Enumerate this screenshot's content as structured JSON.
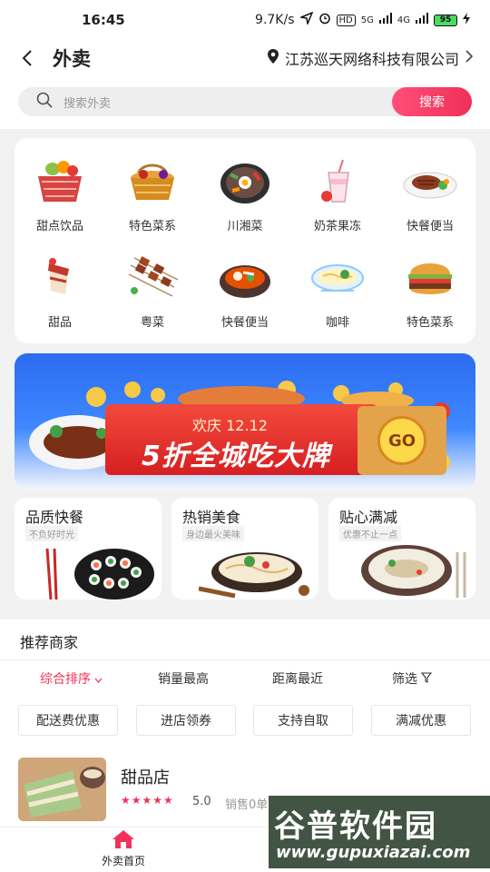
{
  "status_bar": {
    "time": "16:45",
    "speed": "9.7K/s",
    "hd": "HD",
    "network_5g": "5G",
    "network_4g": "4G",
    "battery": "95"
  },
  "nav": {
    "title": "外卖",
    "location": "江苏巡天网络科技有限公司"
  },
  "search": {
    "placeholder": "搜索外卖",
    "button": "搜索"
  },
  "categories": [
    {
      "label": "甜点饮品",
      "icon": "fruit-basket-icon"
    },
    {
      "label": "特色菜系",
      "icon": "bread-basket-icon"
    },
    {
      "label": "川湘菜",
      "icon": "bibimbap-icon"
    },
    {
      "label": "奶茶果冻",
      "icon": "milkshake-icon"
    },
    {
      "label": "快餐便当",
      "icon": "steak-plate-icon"
    },
    {
      "label": "甜品",
      "icon": "cake-icon"
    },
    {
      "label": "粤菜",
      "icon": "skewers-icon"
    },
    {
      "label": "快餐便当",
      "icon": "hotpot-icon"
    },
    {
      "label": "咖啡",
      "icon": "noodle-bowl-icon"
    },
    {
      "label": "特色菜系",
      "icon": "burger-icon"
    }
  ],
  "banner": {
    "subtitle": "欢庆 12.12",
    "headline": "5折全城吃大牌",
    "go": "GO"
  },
  "promos": [
    {
      "title": "品质快餐",
      "subtitle": "不负好时光"
    },
    {
      "title": "热销美食",
      "subtitle": "身边最火美味"
    },
    {
      "title": "贴心满减",
      "subtitle": "优惠不止一点"
    }
  ],
  "merchants": {
    "title": "推荐商家",
    "sorts": [
      "综合排序",
      "销量最高",
      "距离最近",
      "筛选"
    ],
    "filters": [
      "配送费优惠",
      "进店领券",
      "支持自取",
      "满减优惠"
    ],
    "store": {
      "name": "甜品店",
      "stars": "★★★★★",
      "rating": "5.0",
      "rating_value": 5.0,
      "sales": "销售0单"
    }
  },
  "tabbar": {
    "home_label": "外卖首页"
  },
  "watermark": {
    "big": "谷普软件园",
    "small": "www.gupuxiazai.com"
  },
  "colors": {
    "accent": "#f0325a",
    "banner_blue": "#2b6bf0"
  }
}
